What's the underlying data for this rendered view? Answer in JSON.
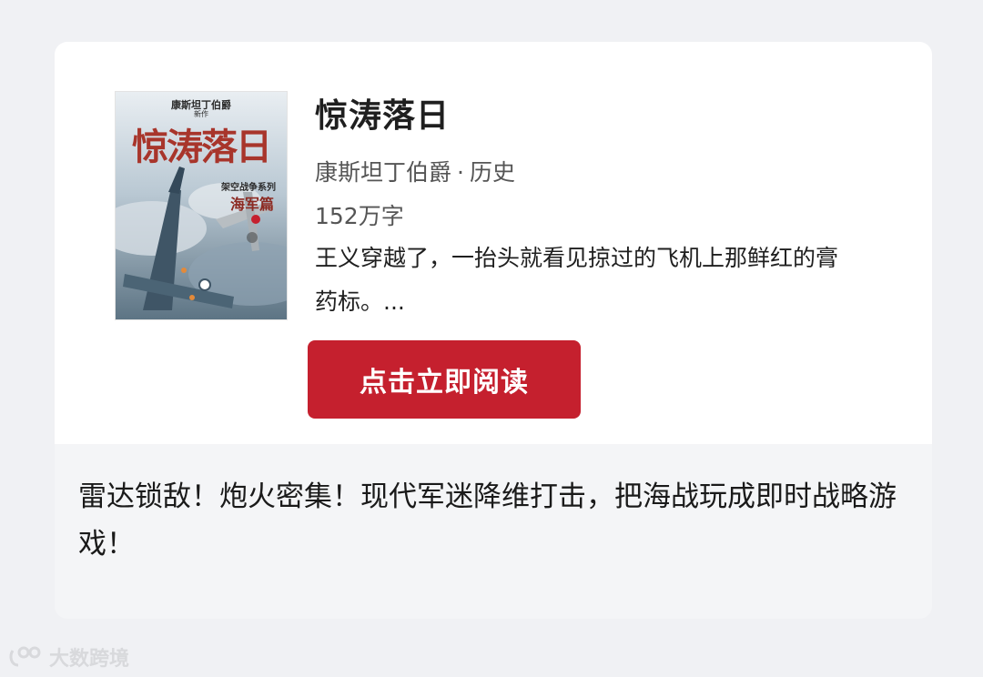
{
  "book": {
    "title": "惊涛落日",
    "author": "康斯坦丁伯爵",
    "separator": "·",
    "genre": "历史",
    "word_count": "152万字",
    "description": "王义穿越了，一抬头就看见掠过的飞机上那鲜红的膏药标。...",
    "cover": {
      "author_line": "康斯坦丁伯爵",
      "tag": "新作",
      "title": "惊涛落日",
      "series": "架空战争系列",
      "volume": "海军篇"
    }
  },
  "action": {
    "read_label": "点击立即阅读"
  },
  "promo_text": "雷达锁敌！炮火密集！现代军迷降维打击，把海战玩成即时战略游戏！",
  "watermark": {
    "text": "大数跨境"
  },
  "colors": {
    "accent": "#c5202e",
    "page_bg": "#f0f1f4",
    "card_bg": "#ffffff",
    "promo_bg": "#f4f5f7"
  }
}
